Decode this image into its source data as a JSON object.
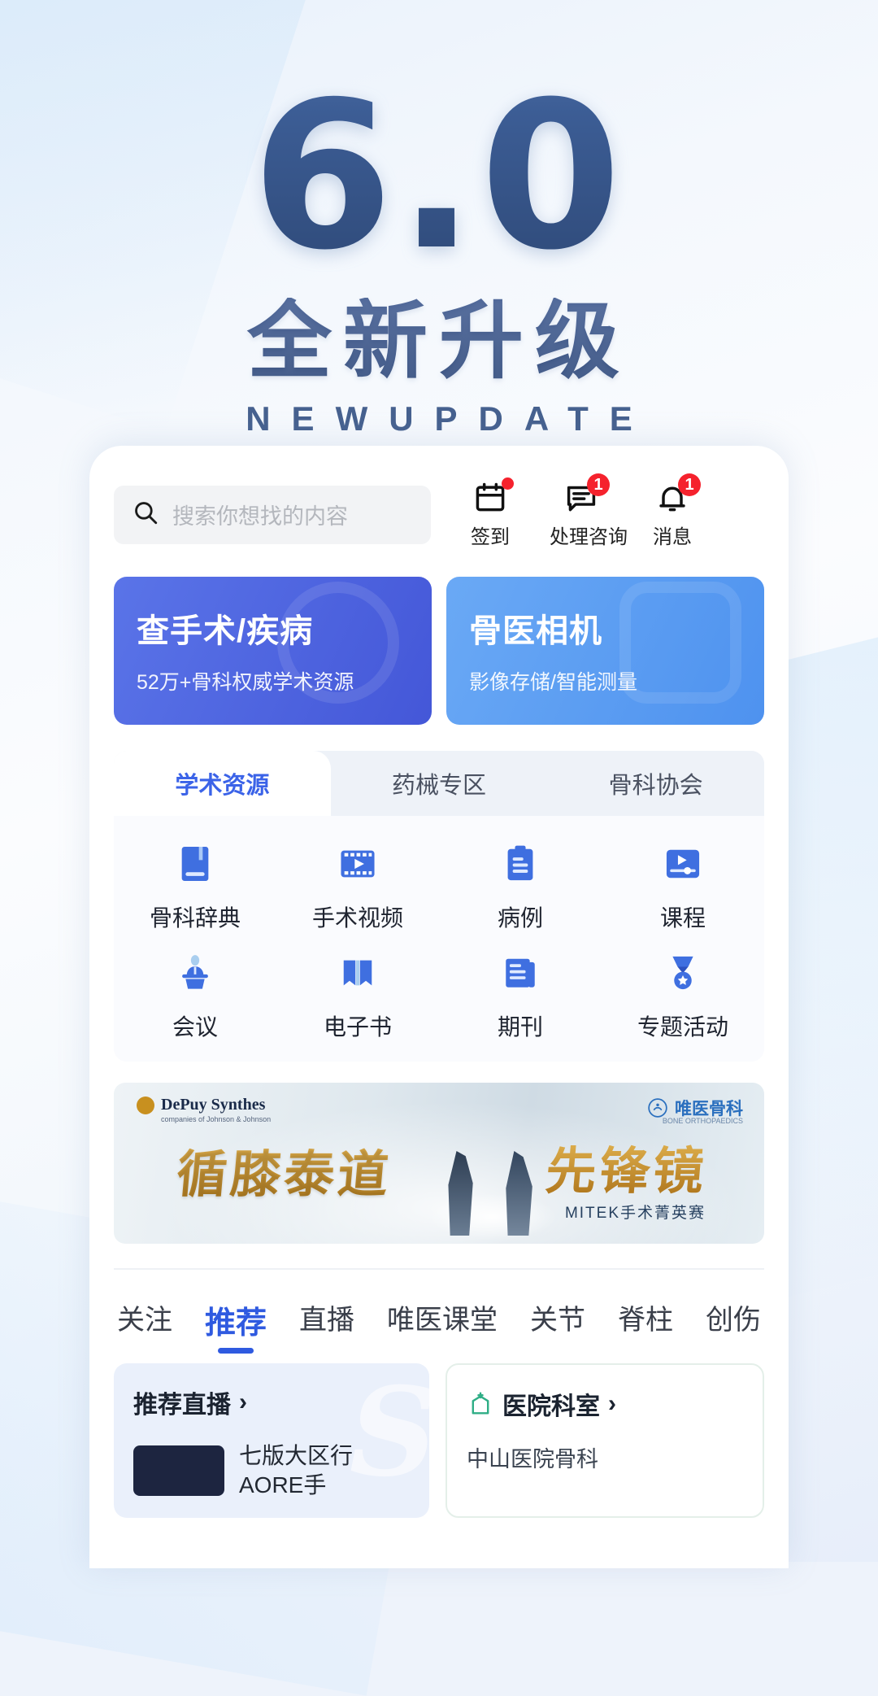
{
  "hero": {
    "version": "6.0",
    "headline": "全新升级",
    "subline": "NEWUPDATE"
  },
  "search": {
    "placeholder": "搜索你想找的内容",
    "icon": "search-icon"
  },
  "top_actions": [
    {
      "label": "签到",
      "icon": "calendar-icon",
      "badge": "",
      "dot": true
    },
    {
      "label": "处理咨询",
      "icon": "message-board-icon",
      "badge": "1",
      "dot": false
    },
    {
      "label": "消息",
      "icon": "bell-icon",
      "badge": "1",
      "dot": false
    }
  ],
  "banners": [
    {
      "title": "查手术/疾病",
      "subtitle": "52万+骨科权威学术资源",
      "color": "#4457d8"
    },
    {
      "title": "骨医相机",
      "subtitle": "影像存储/智能测量",
      "color": "#4e92ef"
    }
  ],
  "panel": {
    "tabs": [
      {
        "label": "学术资源",
        "active": true
      },
      {
        "label": "药械专区",
        "active": false
      },
      {
        "label": "骨科协会",
        "active": false
      }
    ],
    "grid": [
      {
        "label": "骨科辞典",
        "icon": "book-icon"
      },
      {
        "label": "手术视频",
        "icon": "film-play-icon"
      },
      {
        "label": "病例",
        "icon": "clipboard-icon"
      },
      {
        "label": "课程",
        "icon": "video-slider-icon"
      },
      {
        "label": "会议",
        "icon": "podium-speaker-icon"
      },
      {
        "label": "电子书",
        "icon": "open-book-icon"
      },
      {
        "label": "期刊",
        "icon": "journal-icon"
      },
      {
        "label": "专题活动",
        "icon": "medal-icon"
      }
    ]
  },
  "promo": {
    "brand_left": "DePuy Synthes",
    "brand_left_sub": "companies of Johnson & Johnson",
    "brand_right": "唯医骨科",
    "brand_right_sub": "BONE ORTHOPAEDICS",
    "title_left": "循膝泰道",
    "title_right": "先锋镜",
    "caption": "MITEK手术菁英赛"
  },
  "feed": {
    "tabs": [
      {
        "label": "关注",
        "active": false
      },
      {
        "label": "推荐",
        "active": true
      },
      {
        "label": "直播",
        "active": false
      },
      {
        "label": "唯医课堂",
        "active": false
      },
      {
        "label": "关节",
        "active": false
      },
      {
        "label": "脊柱",
        "active": false
      },
      {
        "label": "创伤",
        "active": false
      }
    ],
    "cards": [
      {
        "title": "推荐直播",
        "chevron": "›",
        "body": "七版大区行 AORE手",
        "icon": ""
      },
      {
        "title": "医院科室",
        "chevron": "›",
        "body": "中山医院骨科",
        "icon": "hospital-icon"
      }
    ]
  },
  "colors": {
    "primary": "#3b63e8",
    "accent_blue": "#4457d8",
    "badge_red": "#f5222d",
    "hero_navy": "#3a5280"
  }
}
